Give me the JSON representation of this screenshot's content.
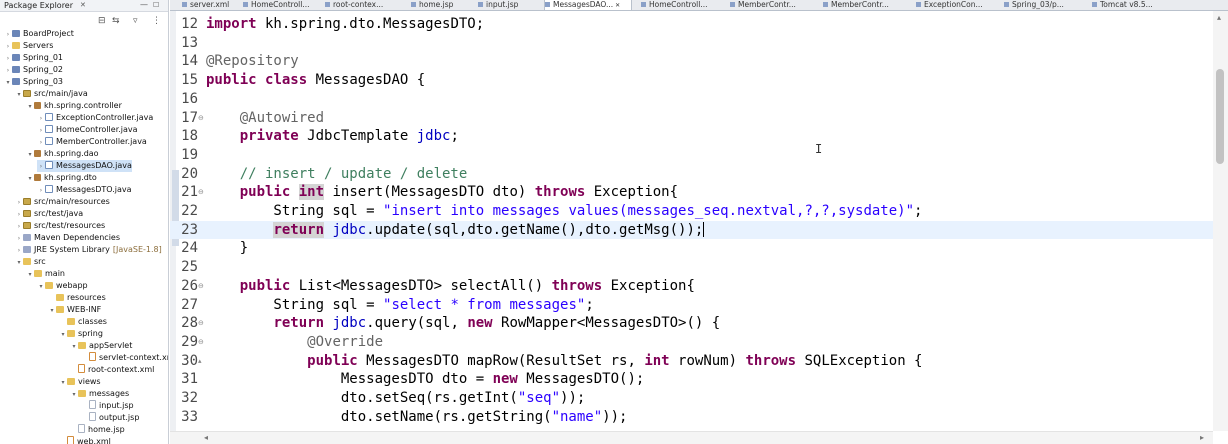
{
  "explorer": {
    "title": "Package Explorer",
    "tree": [
      {
        "label": "BoardProject",
        "icon": "project",
        "depth": 0,
        "twisty": "collapsed"
      },
      {
        "label": "Servers",
        "icon": "folder",
        "depth": 0,
        "twisty": "collapsed"
      },
      {
        "label": "Spring_01",
        "icon": "project",
        "depth": 0,
        "twisty": "collapsed"
      },
      {
        "label": "Spring_02",
        "icon": "project",
        "depth": 0,
        "twisty": "collapsed"
      },
      {
        "label": "Spring_03",
        "icon": "project",
        "depth": 0,
        "twisty": "expanded"
      },
      {
        "label": "src/main/java",
        "icon": "srcfolder",
        "depth": 1,
        "twisty": "expanded"
      },
      {
        "label": "kh.spring.controller",
        "icon": "package",
        "depth": 2,
        "twisty": "expanded"
      },
      {
        "label": "ExceptionController.java",
        "icon": "java",
        "depth": 3,
        "twisty": "collapsed"
      },
      {
        "label": "HomeController.java",
        "icon": "java",
        "depth": 3,
        "twisty": "collapsed"
      },
      {
        "label": "MemberController.java",
        "icon": "java",
        "depth": 3,
        "twisty": "collapsed"
      },
      {
        "label": "kh.spring.dao",
        "icon": "package",
        "depth": 2,
        "twisty": "expanded"
      },
      {
        "label": "MessagesDAO.java",
        "icon": "java",
        "depth": 3,
        "twisty": "collapsed",
        "selected": true
      },
      {
        "label": "kh.spring.dto",
        "icon": "package",
        "depth": 2,
        "twisty": "expanded"
      },
      {
        "label": "MessagesDTO.java",
        "icon": "java",
        "depth": 3,
        "twisty": "collapsed"
      },
      {
        "label": "src/main/resources",
        "icon": "srcfolder",
        "depth": 1,
        "twisty": "collapsed"
      },
      {
        "label": "src/test/java",
        "icon": "srcfolder",
        "depth": 1,
        "twisty": "collapsed"
      },
      {
        "label": "src/test/resources",
        "icon": "srcfolder",
        "depth": 1,
        "twisty": "collapsed"
      },
      {
        "label": "Maven Dependencies",
        "icon": "lib",
        "depth": 1,
        "twisty": "collapsed"
      },
      {
        "label": "JRE System Library",
        "icon": "lib",
        "depth": 1,
        "twisty": "collapsed",
        "decoration": "[JavaSE-1.8]"
      },
      {
        "label": "src",
        "icon": "folder",
        "depth": 1,
        "twisty": "expanded"
      },
      {
        "label": "main",
        "icon": "folder",
        "depth": 2,
        "twisty": "expanded"
      },
      {
        "label": "webapp",
        "icon": "folder",
        "depth": 3,
        "twisty": "expanded"
      },
      {
        "label": "resources",
        "icon": "folder",
        "depth": 4,
        "twisty": "none"
      },
      {
        "label": "WEB-INF",
        "icon": "folder",
        "depth": 4,
        "twisty": "expanded"
      },
      {
        "label": "classes",
        "icon": "folder",
        "depth": 5,
        "twisty": "none"
      },
      {
        "label": "spring",
        "icon": "folder",
        "depth": 5,
        "twisty": "expanded"
      },
      {
        "label": "appServlet",
        "icon": "folder",
        "depth": 6,
        "twisty": "expanded"
      },
      {
        "label": "servlet-context.xml",
        "icon": "xml",
        "depth": 7,
        "twisty": "none"
      },
      {
        "label": "root-context.xml",
        "icon": "xml",
        "depth": 6,
        "twisty": "none"
      },
      {
        "label": "views",
        "icon": "folder",
        "depth": 5,
        "twisty": "expanded"
      },
      {
        "label": "messages",
        "icon": "folder",
        "depth": 6,
        "twisty": "expanded"
      },
      {
        "label": "input.jsp",
        "icon": "file",
        "depth": 7,
        "twisty": "none"
      },
      {
        "label": "output.jsp",
        "icon": "file",
        "depth": 7,
        "twisty": "none"
      },
      {
        "label": "home.jsp",
        "icon": "file",
        "depth": 6,
        "twisty": "none"
      },
      {
        "label": "web.xml",
        "icon": "xml",
        "depth": 5,
        "twisty": "none"
      }
    ]
  },
  "tabs": [
    {
      "label": "server.xml",
      "active": false
    },
    {
      "label": "HomeControll...",
      "active": false
    },
    {
      "label": "root-contex...",
      "active": false
    },
    {
      "label": "home.jsp",
      "active": false
    },
    {
      "label": "input.jsp",
      "active": false
    },
    {
      "label": "MessagesDAO...",
      "active": true
    },
    {
      "label": "HomeControll...",
      "active": false
    },
    {
      "label": "MemberContr...",
      "active": false
    },
    {
      "label": "MemberContr...",
      "active": false
    },
    {
      "label": "ExceptionCon...",
      "active": false
    },
    {
      "label": "Spring_03/p...",
      "active": false
    },
    {
      "label": "Tomcat v8.5...",
      "active": false
    }
  ],
  "editor": {
    "current_line": 23,
    "lines": [
      {
        "num": "12",
        "fold": "",
        "tokens": [
          {
            "t": "import",
            "c": "kw"
          },
          {
            "t": " kh.spring.dto.MessagesDTO;"
          }
        ]
      },
      {
        "num": "13",
        "fold": "",
        "tokens": []
      },
      {
        "num": "14",
        "fold": "",
        "tokens": [
          {
            "t": "@Repository",
            "c": "ann"
          }
        ]
      },
      {
        "num": "15",
        "fold": "",
        "tokens": [
          {
            "t": "public",
            "c": "kw"
          },
          {
            "t": " "
          },
          {
            "t": "class",
            "c": "kw"
          },
          {
            "t": " MessagesDAO {"
          }
        ]
      },
      {
        "num": "16",
        "fold": "",
        "tokens": []
      },
      {
        "num": "17",
        "fold": "⊖",
        "tokens": [
          {
            "t": "    "
          },
          {
            "t": "@Autowired",
            "c": "ann"
          }
        ]
      },
      {
        "num": "18",
        "fold": "",
        "tokens": [
          {
            "t": "    "
          },
          {
            "t": "private",
            "c": "kw"
          },
          {
            "t": " JdbcTemplate "
          },
          {
            "t": "jdbc",
            "c": "fld"
          },
          {
            "t": ";"
          }
        ]
      },
      {
        "num": "19",
        "fold": "",
        "tokens": []
      },
      {
        "num": "20",
        "fold": "",
        "tokens": [
          {
            "t": "    "
          },
          {
            "t": "// insert / update / delete",
            "c": "cmt"
          }
        ]
      },
      {
        "num": "21",
        "fold": "⊖",
        "tokens": [
          {
            "t": "    "
          },
          {
            "t": "public",
            "c": "kw"
          },
          {
            "t": " "
          },
          {
            "t": "int",
            "c": "kw hl"
          },
          {
            "t": " insert(MessagesDTO dto) "
          },
          {
            "t": "throws",
            "c": "kw"
          },
          {
            "t": " Exception{"
          }
        ]
      },
      {
        "num": "22",
        "fold": "",
        "tokens": [
          {
            "t": "        String sql = "
          },
          {
            "t": "\"insert into messages values(messages_seq.nextval,?,?,sysdate)\"",
            "c": "str"
          },
          {
            "t": ";"
          }
        ]
      },
      {
        "num": "23",
        "fold": "",
        "tokens": [
          {
            "t": "        "
          },
          {
            "t": "return",
            "c": "kw hl"
          },
          {
            "t": " "
          },
          {
            "t": "jdbc",
            "c": "fld"
          },
          {
            "t": ".update(sql,dto.getName(),dto.getMsg());"
          }
        ]
      },
      {
        "num": "24",
        "fold": "",
        "tokens": [
          {
            "t": "    }"
          }
        ]
      },
      {
        "num": "25",
        "fold": "",
        "tokens": []
      },
      {
        "num": "26",
        "fold": "⊖",
        "tokens": [
          {
            "t": "    "
          },
          {
            "t": "public",
            "c": "kw"
          },
          {
            "t": " List<MessagesDTO> selectAll() "
          },
          {
            "t": "throws",
            "c": "kw"
          },
          {
            "t": " Exception{"
          }
        ]
      },
      {
        "num": "27",
        "fold": "",
        "tokens": [
          {
            "t": "        String sql = "
          },
          {
            "t": "\"select * from messages\"",
            "c": "str"
          },
          {
            "t": ";"
          }
        ]
      },
      {
        "num": "28",
        "fold": "⊖",
        "tokens": [
          {
            "t": "        "
          },
          {
            "t": "return",
            "c": "kw"
          },
          {
            "t": " "
          },
          {
            "t": "jdbc",
            "c": "fld"
          },
          {
            "t": ".query(sql, "
          },
          {
            "t": "new",
            "c": "kw"
          },
          {
            "t": " RowMapper<MessagesDTO>() {"
          }
        ]
      },
      {
        "num": "29",
        "fold": "⊖",
        "tokens": [
          {
            "t": "            "
          },
          {
            "t": "@Override",
            "c": "ann"
          }
        ]
      },
      {
        "num": "30",
        "fold": "▴",
        "tokens": [
          {
            "t": "            "
          },
          {
            "t": "public",
            "c": "kw"
          },
          {
            "t": " MessagesDTO mapRow(ResultSet rs, "
          },
          {
            "t": "int",
            "c": "kw"
          },
          {
            "t": " rowNum) "
          },
          {
            "t": "throws",
            "c": "kw"
          },
          {
            "t": " SQLException {"
          }
        ]
      },
      {
        "num": "31",
        "fold": "",
        "tokens": [
          {
            "t": "                MessagesDTO dto = "
          },
          {
            "t": "new",
            "c": "kw"
          },
          {
            "t": " MessagesDTO();"
          }
        ]
      },
      {
        "num": "32",
        "fold": "",
        "tokens": [
          {
            "t": "                dto.setSeq(rs.getInt("
          },
          {
            "t": "\"seq\"",
            "c": "str"
          },
          {
            "t": "));"
          }
        ]
      },
      {
        "num": "33",
        "fold": "",
        "tokens": [
          {
            "t": "                dto.setName(rs.getString("
          },
          {
            "t": "\"name\"",
            "c": "str"
          },
          {
            "t": "));"
          }
        ]
      }
    ]
  }
}
